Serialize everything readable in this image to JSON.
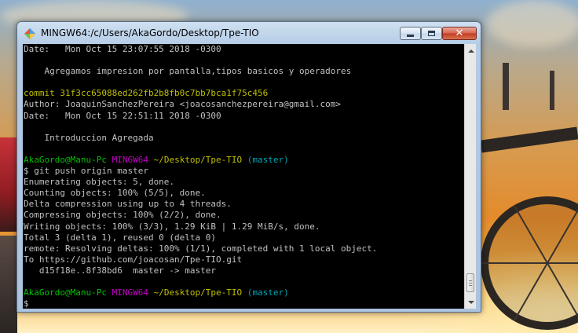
{
  "window": {
    "title": "MINGW64:/c/Users/AkaGordo/Desktop/Tpe-TIO",
    "icon": "git-bash-icon",
    "controls": {
      "minimize": "minimize-icon",
      "maximize": "maximize-icon",
      "close": "✕"
    }
  },
  "terminal": {
    "line0": {
      "text": "Date:   Mon Oct 15 23:07:55 2018 -0300"
    },
    "line1": {
      "text": ""
    },
    "line2": {
      "text": "    Agregamos impresion por pantalla,tipos basicos y operadores"
    },
    "line3": {
      "text": ""
    },
    "line4": {
      "text": "commit 31f3cc65088ed262fb2b8fb0c7bb7bca1f75c456"
    },
    "line5": {
      "text": "Author: JoaquinSanchezPereira <joacosanchezpereira@gmail.com>"
    },
    "line6": {
      "text": "Date:   Mon Oct 15 22:51:11 2018 -0300"
    },
    "line7": {
      "text": ""
    },
    "line8": {
      "text": "    Introduccion Agregada"
    },
    "line9": {
      "text": ""
    },
    "line10": {
      "user": "AkaGordo@Manu-Pc",
      "env": "MINGW64",
      "path": "~/Desktop/Tpe-TIO",
      "branch": "(master)"
    },
    "line11": {
      "text": "$ git push origin master"
    },
    "line12": {
      "text": "Enumerating objects: 5, done."
    },
    "line13": {
      "text": "Counting objects: 100% (5/5), done."
    },
    "line14": {
      "text": "Delta compression using up to 4 threads."
    },
    "line15": {
      "text": "Compressing objects: 100% (2/2), done."
    },
    "line16": {
      "text": "Writing objects: 100% (3/3), 1.29 KiB | 1.29 MiB/s, done."
    },
    "line17": {
      "text": "Total 3 (delta 1), reused 0 (delta 0)"
    },
    "line18": {
      "text": "remote: Resolving deltas: 100% (1/1), completed with 1 local object."
    },
    "line19": {
      "text": "To https://github.com/joacosan/Tpe-TIO.git"
    },
    "line20": {
      "text": "   d15f18e..8f38bd6  master -> master"
    },
    "line21": {
      "text": ""
    },
    "line22": {
      "user": "AkaGordo@Manu-Pc",
      "env": "MINGW64",
      "path": "~/Desktop/Tpe-TIO",
      "branch": "(master)"
    },
    "line23": {
      "text": "$"
    }
  },
  "colors": {
    "prompt_user": "#00bf00",
    "prompt_env": "#bf00bf",
    "prompt_path": "#bfbf00",
    "prompt_branch": "#00a6b2",
    "commit_hash": "#bfbf00",
    "text": "#c0c0c0",
    "background": "#000000"
  },
  "scrollbar": {
    "position": 0.96
  }
}
